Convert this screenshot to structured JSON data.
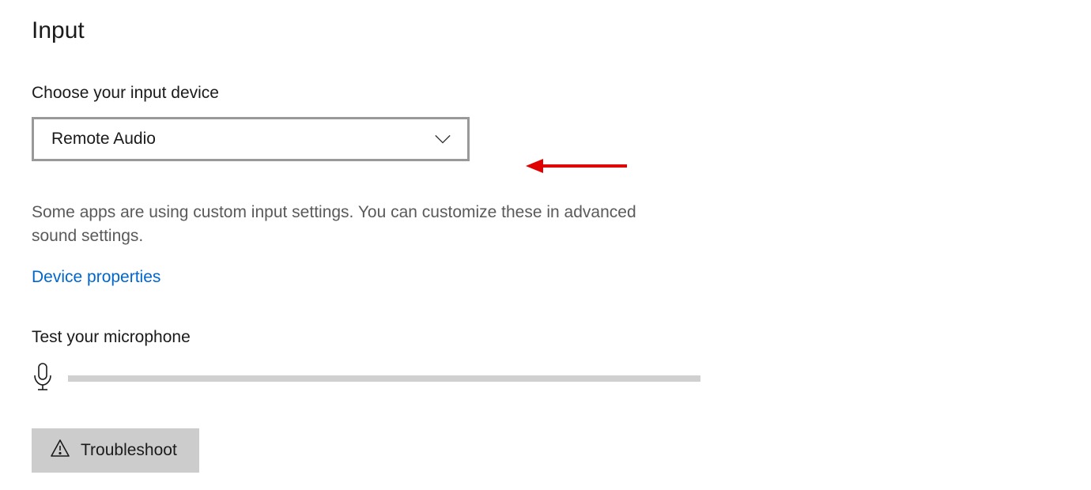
{
  "section": {
    "title": "Input",
    "choose_label": "Choose your input device",
    "dropdown_value": "Remote Audio",
    "help_text": "Some apps are using custom input settings. You can customize these in advanced sound settings.",
    "device_properties_link": "Device properties",
    "test_label": "Test your microphone",
    "troubleshoot_label": "Troubleshoot"
  }
}
